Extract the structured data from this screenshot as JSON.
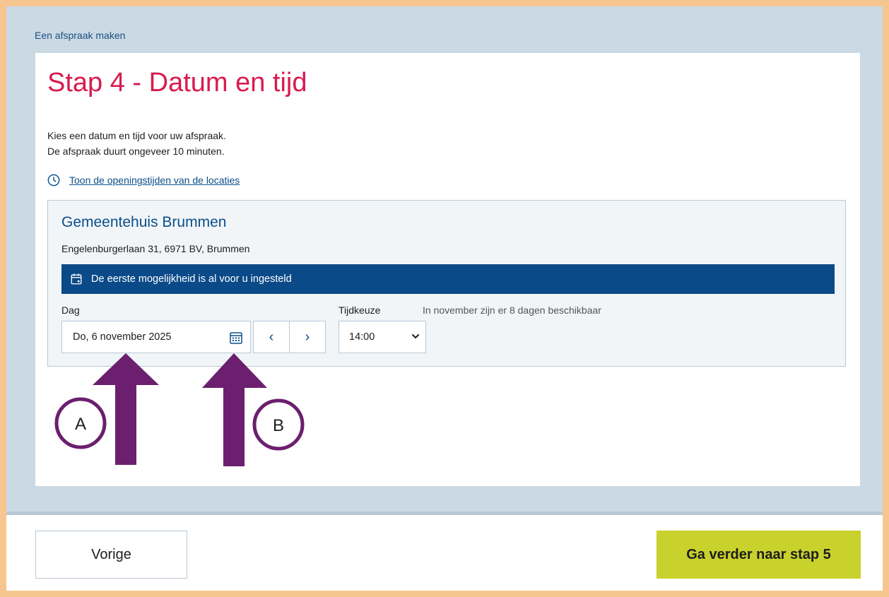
{
  "breadcrumb": "Een afspraak maken",
  "page_title": "Stap 4 - Datum en tijd",
  "intro": {
    "line1": "Kies een datum en tijd voor uw afspraak.",
    "line2": "De afspraak duurt ongeveer 10 minuten."
  },
  "hours_link": {
    "icon": "clock-icon",
    "label": "Toon de openingstijden van de locaties"
  },
  "location": {
    "name": "Gemeentehuis Brummen",
    "address": "Engelenburgerlaan 31, 6971 BV, Brummen",
    "notice": "De eerste mogelijkheid is al voor u ingesteld",
    "notice_icon": "calendar-icon",
    "day_label": "Dag",
    "day_value": "Do, 6 november 2025",
    "prev_day_label": "‹",
    "next_day_label": "›",
    "time_label": "Tijdkeuze",
    "time_value": "14:00",
    "availability": "In november zijn er 8 dagen beschikbaar"
  },
  "annotations": {
    "a_label": "A",
    "b_label": "B",
    "color": "#6b1f6e"
  },
  "footer": {
    "prev_label": "Vorige",
    "next_label": "Ga verder naar stap 5"
  },
  "colors": {
    "title": "#d81b4e",
    "link": "#0b4f8a",
    "notice_bg": "#0b4a88",
    "next_button": "#c9d12c",
    "outer_border": "#f5c690",
    "frame_bg": "#cbd9e5"
  }
}
